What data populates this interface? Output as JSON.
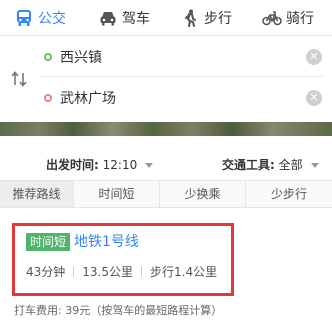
{
  "modes": [
    {
      "label": "公交",
      "icon": "bus-icon",
      "active": true
    },
    {
      "label": "驾车",
      "icon": "car-icon",
      "active": false
    },
    {
      "label": "步行",
      "icon": "walk-icon",
      "active": false
    },
    {
      "label": "骑行",
      "icon": "bike-icon",
      "active": false
    }
  ],
  "route": {
    "start": "西兴镇",
    "end": "武林广场"
  },
  "options": {
    "time_label": "出发时间:",
    "time_value": "12:10",
    "tool_label": "交通工具:",
    "tool_value": "全部"
  },
  "tabs": [
    "推荐路线",
    "时间短",
    "少换乘",
    "少步行"
  ],
  "result": {
    "tag": "时间短",
    "line": "地铁1号线",
    "duration": "43分钟",
    "distance": "13.5公里",
    "walk": "步行1.4公里"
  },
  "fare_note": "打车费用: 39元（按驾车的最短路程计算）",
  "colors": {
    "accent": "#3385ff",
    "tag_green": "#4fb56b",
    "highlight_border": "#e03a3a",
    "start_dot": "#6fc05b",
    "end_dot": "#ef7f80"
  }
}
